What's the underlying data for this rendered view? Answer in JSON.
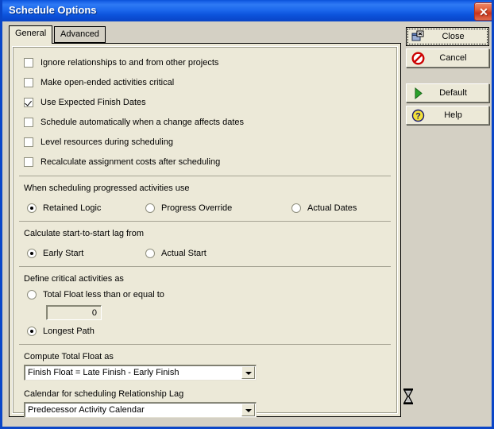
{
  "window": {
    "title": "Schedule Options",
    "close_icon": "window-close-icon",
    "accent_titlebar": "#1c68ec",
    "face_color": "#d4d0c4",
    "panel_color": "#ece9d8"
  },
  "tabs": [
    {
      "label": "General",
      "active": true
    },
    {
      "label": "Advanced",
      "active": false
    }
  ],
  "checkbox_group": {
    "items": [
      {
        "label": "Ignore relationships to and from other projects",
        "checked": false
      },
      {
        "label": "Make open-ended activities critical",
        "checked": false
      },
      {
        "label": "Use Expected Finish Dates",
        "checked": true
      },
      {
        "label": "Schedule automatically when a change affects dates",
        "checked": false
      },
      {
        "label": "Level resources during scheduling",
        "checked": false
      },
      {
        "label": "Recalculate assignment costs after scheduling",
        "checked": false
      }
    ]
  },
  "progressed_group": {
    "label": "When scheduling progressed activities use",
    "options": [
      {
        "label": "Retained Logic",
        "selected": true
      },
      {
        "label": "Progress Override",
        "selected": false
      },
      {
        "label": "Actual Dates",
        "selected": false
      }
    ]
  },
  "lag_group": {
    "label": "Calculate start-to-start lag from",
    "options": [
      {
        "label": "Early Start",
        "selected": true
      },
      {
        "label": "Actual Start",
        "selected": false
      }
    ]
  },
  "critical_group": {
    "label": "Define critical activities as",
    "option_total_float": {
      "label": "Total Float less than or equal to",
      "selected": false
    },
    "total_float_value": "0",
    "option_longest_path": {
      "label": "Longest Path",
      "selected": true
    }
  },
  "float_group": {
    "compute_label": "Compute Total Float as",
    "compute_value": "Finish Float = Late Finish - Early Finish",
    "calendar_label": "Calendar for scheduling Relationship Lag",
    "calendar_value": "Predecessor Activity Calendar"
  },
  "buttons": [
    {
      "label": "Close",
      "icon": "close-window-icon",
      "focused": true
    },
    {
      "label": "Cancel",
      "icon": "cancel-circle-icon",
      "focused": false
    },
    {
      "label": "Default",
      "icon": "play-triangle-icon",
      "focused": false
    },
    {
      "label": "Help",
      "icon": "help-question-icon",
      "focused": false
    }
  ],
  "cursor": {
    "icon": "hourglass-cursor-icon"
  }
}
